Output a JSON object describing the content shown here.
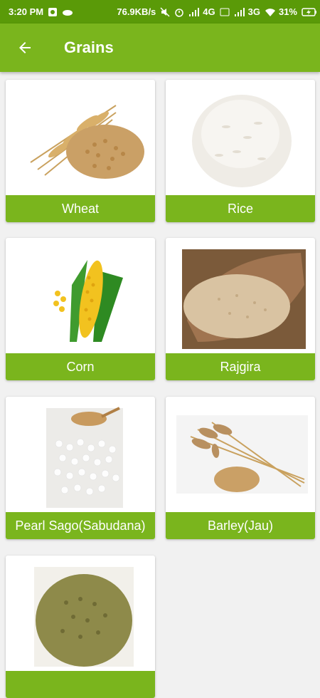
{
  "status": {
    "time": "3:20 PM",
    "speed": "76.9KB/s",
    "network1": "4G",
    "network2": "3G",
    "battery": "31%"
  },
  "header": {
    "title": "Grains",
    "back_icon": "arrow-left-icon"
  },
  "grains": [
    {
      "label": "Wheat"
    },
    {
      "label": "Rice"
    },
    {
      "label": "Corn"
    },
    {
      "label": "Rajgira"
    },
    {
      "label": "Pearl Sago(Sabudana)"
    },
    {
      "label": "Barley(Jau)"
    },
    {
      "label": ""
    }
  ],
  "colors": {
    "primary": "#7ab51d",
    "status_bar": "#5a9a08",
    "background": "#f1f1f1"
  }
}
